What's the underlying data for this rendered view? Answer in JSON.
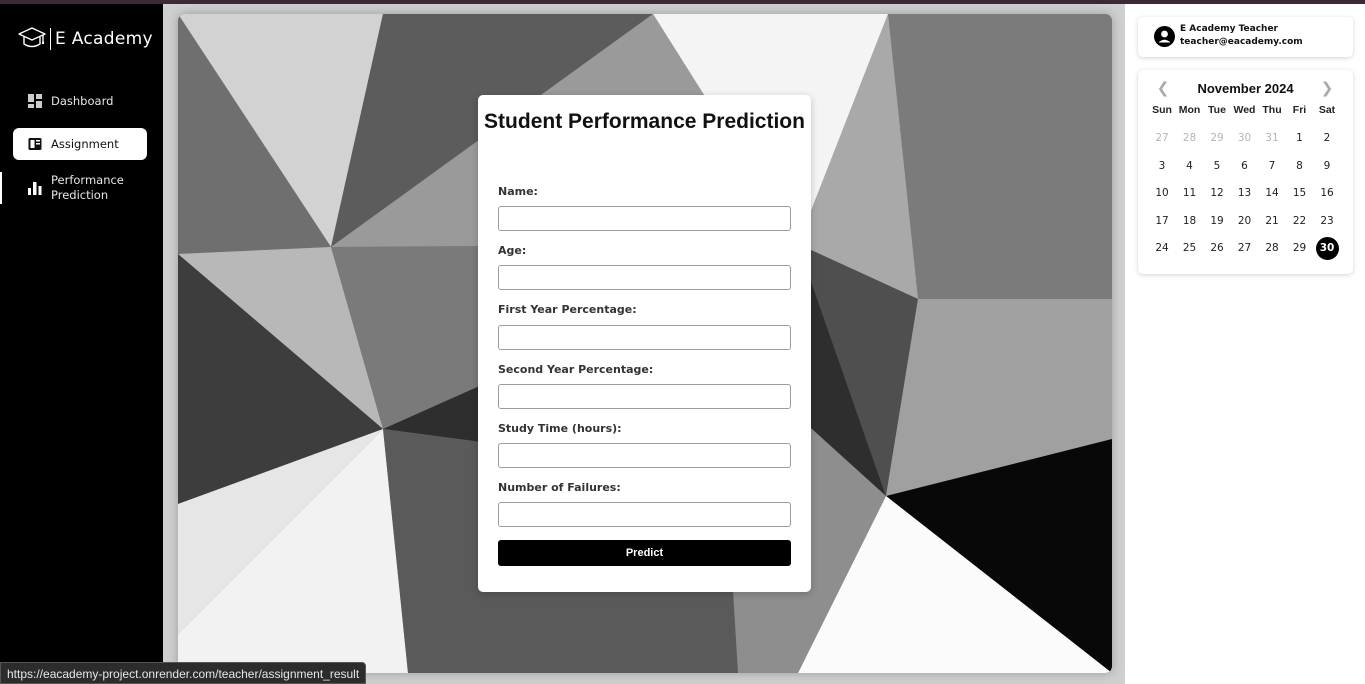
{
  "sidebar": {
    "logo_text": "E Academy",
    "items": [
      {
        "label": "Dashboard"
      },
      {
        "label": "Assignment"
      },
      {
        "label": "Performance Prediction"
      }
    ]
  },
  "form": {
    "title": "Student Performance Prediction",
    "fields": [
      {
        "label": "Name:",
        "value": ""
      },
      {
        "label": "Age:",
        "value": ""
      },
      {
        "label": "First Year Percentage:",
        "value": ""
      },
      {
        "label": "Second Year Percentage:",
        "value": ""
      },
      {
        "label": "Study Time (hours):",
        "value": ""
      },
      {
        "label": "Number of Failures:",
        "value": ""
      }
    ],
    "submit_label": "Predict"
  },
  "profile": {
    "name": "E Academy Teacher",
    "email": "teacher@eacademy.com",
    "icon": "user-circle-icon"
  },
  "calendar": {
    "month_label": "November 2024",
    "weekdays": [
      "Sun",
      "Mon",
      "Tue",
      "Wed",
      "Thu",
      "Fri",
      "Sat"
    ],
    "weeks": [
      [
        "27",
        "28",
        "29",
        "30",
        "31",
        "1",
        "2"
      ],
      [
        "3",
        "4",
        "5",
        "6",
        "7",
        "8",
        "9"
      ],
      [
        "10",
        "11",
        "12",
        "13",
        "14",
        "15",
        "16"
      ],
      [
        "17",
        "18",
        "19",
        "20",
        "21",
        "22",
        "23"
      ],
      [
        "24",
        "25",
        "26",
        "27",
        "28",
        "29",
        "30"
      ]
    ],
    "selected_day": "30",
    "prev_icon": "chevron-left-icon",
    "next_icon": "chevron-right-icon"
  },
  "status_bar": {
    "url": "https://eacademy-project.onrender.com/teacher/assignment_result"
  },
  "colors": {
    "sidebar_bg": "#000000",
    "accent": "#000000",
    "topbar": "#3a2a36"
  }
}
